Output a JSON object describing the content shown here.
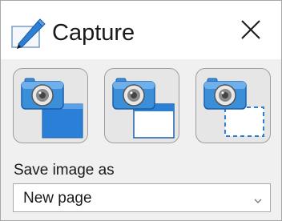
{
  "titlebar": {
    "title": "Capture",
    "title_icon": "pen-on-screen-icon",
    "close_icon": "close-icon"
  },
  "capture_buttons": [
    {
      "name": "capture-full-screen",
      "icon": "camera-full-screen-icon"
    },
    {
      "name": "capture-window",
      "icon": "camera-window-icon"
    },
    {
      "name": "capture-region",
      "icon": "camera-region-icon"
    }
  ],
  "save": {
    "label": "Save image as",
    "selected": "New page"
  },
  "colors": {
    "accent_blue": "#1f78d1",
    "camera_blue": "#3b8fd9",
    "panel_bg": "#f0f0f0"
  }
}
